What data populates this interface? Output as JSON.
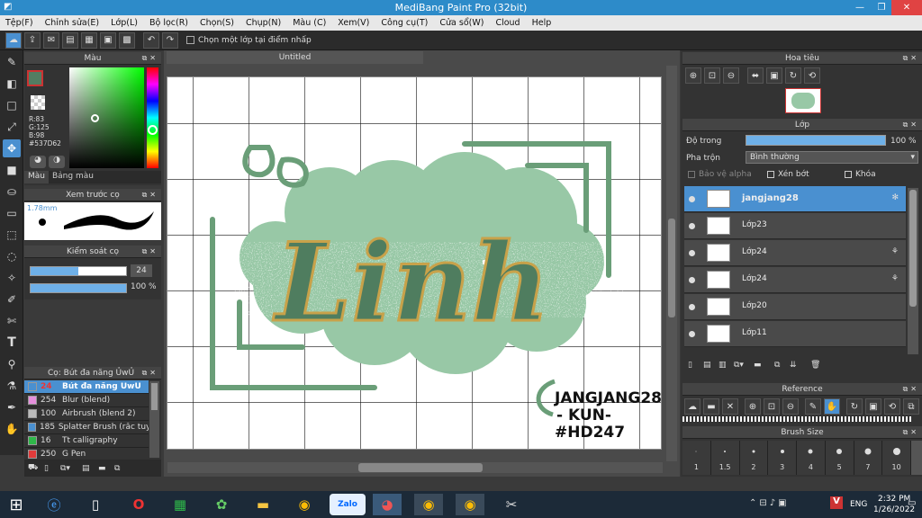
{
  "window": {
    "title": "MediBang Paint Pro (32bit)"
  },
  "menu": [
    "Tệp(F)",
    "Chỉnh sửa(E)",
    "Lớp(L)",
    "Bộ lọc(R)",
    "Chọn(S)",
    "Chụp(N)",
    "Màu (C)",
    "Xem(V)",
    "Công cụ(T)",
    "Cửa sổ(W)",
    "Cloud",
    "Help"
  ],
  "toolbar": {
    "snap_label": "Chọn một lớp tại điểm nhấp"
  },
  "color_panel": {
    "title": "Màu",
    "r": "R:83",
    "g": "G:125",
    "b": "B:98",
    "hex": "#537D62",
    "tabs": [
      "Màu",
      "Bảng màu"
    ],
    "current": "#537d62"
  },
  "brush_preview": {
    "title": "Xem trước cọ",
    "size": "1.78mm"
  },
  "brush_control": {
    "title": "Kiểm soát cọ",
    "size_value": "24",
    "opacity_value": "100 %",
    "size_fraction": 0.5,
    "opacity_fraction": 1.0
  },
  "brush_list": {
    "title": "Cọ: Bút đa năng ỦwỦ",
    "items": [
      {
        "size": "24",
        "name": "Bút đa năng ỦwỦ",
        "color": "#4a90d0"
      },
      {
        "size": "254",
        "name": "Blur (blend)",
        "color": "#e58fdc"
      },
      {
        "size": "100",
        "name": "Airbrush (blend 2)",
        "color": "#bbbbbb"
      },
      {
        "size": "185",
        "name": "Splatter Brush (rắc tuyết)",
        "color": "#4a90d0"
      },
      {
        "size": "16",
        "name": "Tt calligraphy",
        "color": "#2fb84a"
      },
      {
        "size": "250",
        "name": "G Pen",
        "color": "#e03b3b"
      }
    ]
  },
  "document": {
    "tab_title": "Untitled"
  },
  "artwork": {
    "main_text": "Linh",
    "signature_lines": [
      "JANGJANG28",
      "- KUN-",
      "#HD247"
    ],
    "green_dark": "#4f7d5f",
    "green_light": "#98c8a6",
    "green_frame": "#6a9e78",
    "accent": "#c8a24a"
  },
  "navigator": {
    "title": "Hoa tiêu"
  },
  "layer_panel": {
    "title": "Lớp",
    "opacity_label": "Độ trong",
    "opacity_value": "100 %",
    "opacity_fraction": 1.0,
    "blend_label": "Pha trộn",
    "blend_value": "Bình thường",
    "protect_alpha": "Bảo vệ alpha",
    "clipping": "Xén bớt",
    "lock": "Khóa",
    "layers": [
      {
        "name": "jangjang28",
        "selected": true,
        "extra": "✻"
      },
      {
        "name": "Lớp23",
        "selected": false,
        "extra": ""
      },
      {
        "name": "Lớp24",
        "selected": false,
        "extra": "⚘"
      },
      {
        "name": "Lớp24",
        "selected": false,
        "extra": "⚘"
      },
      {
        "name": "Lớp20",
        "selected": false,
        "extra": ""
      },
      {
        "name": "Lớp11",
        "selected": false,
        "extra": ""
      }
    ]
  },
  "reference_panel": {
    "title": "Reference"
  },
  "brush_size_panel": {
    "title": "Brush Size",
    "sizes": [
      "1",
      "1.5",
      "2",
      "3",
      "4",
      "5",
      "7",
      "10"
    ]
  },
  "taskbar": {
    "language": "ENG",
    "time": "2:32 PM",
    "date": "1/26/2022",
    "zalo_label": "Zalo"
  }
}
